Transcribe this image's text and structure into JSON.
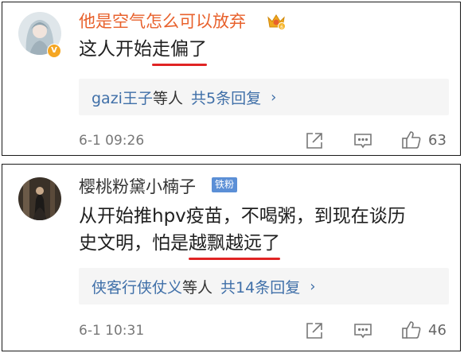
{
  "comments": [
    {
      "username": "他是空气怎么可以放弃",
      "badge_text": "",
      "content_lines": [
        {
          "plain": "这人开始",
          "underlined": "走偏了",
          "rest": ""
        }
      ],
      "replies": {
        "who": "gazi王子",
        "etc": "等人",
        "count": "共5条回复",
        "chevron": "›"
      },
      "time": "6-1 09:26",
      "likes": "63"
    },
    {
      "username": "樱桃粉黛小楠子",
      "badge_text": "铁粉",
      "content_lines": [
        {
          "plain": "从开始推hpv疫苗，不喝粥，到现在谈历",
          "underlined": "",
          "rest": ""
        },
        {
          "plain": "史文明，怕是",
          "underlined": "越飘越远了",
          "rest": ""
        }
      ],
      "replies": {
        "who": "侠客行侠仗义",
        "etc": "等人",
        "count": "共14条回复",
        "chevron": "›"
      },
      "time": "6-1 10:31",
      "likes": "46"
    }
  ],
  "icons": {
    "share": "share-icon",
    "comment": "comment-icon",
    "like": "like-icon",
    "vip": "vip-badge-icon",
    "crown": "crown-icon"
  },
  "colors": {
    "vip_name": "#e8612c",
    "link": "#3f6fa8",
    "underline": "#e02424",
    "badge": "#5b8fd6"
  }
}
